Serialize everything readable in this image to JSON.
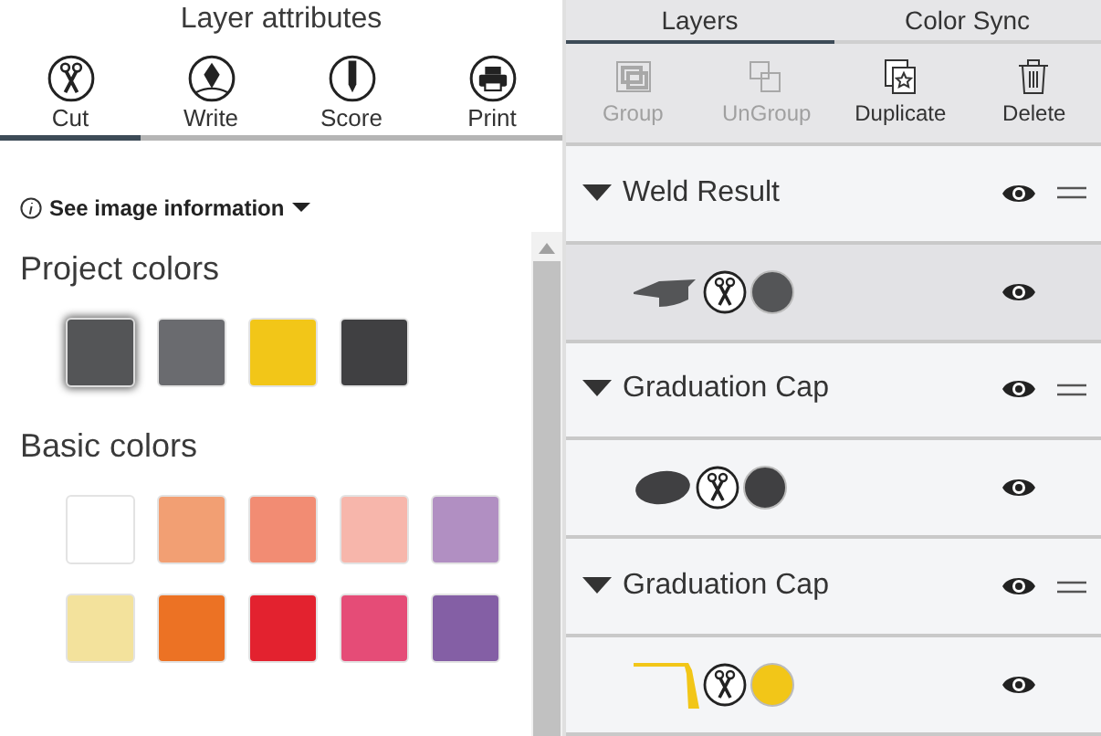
{
  "left_panel": {
    "title": "Layer attributes",
    "tabs": [
      {
        "label": "Cut",
        "kind": "cut",
        "selected": true
      },
      {
        "label": "Write",
        "kind": "write",
        "selected": false
      },
      {
        "label": "Score",
        "kind": "score",
        "selected": false
      },
      {
        "label": "Print",
        "kind": "print",
        "selected": false
      }
    ],
    "info_link": "See image information",
    "sections": [
      {
        "title": "Project colors",
        "swatches": [
          {
            "color": "#545557",
            "selected": true
          },
          {
            "color": "#6a6b6f",
            "selected": false
          },
          {
            "color": "#f2c618",
            "selected": false
          },
          {
            "color": "#404042",
            "selected": false
          }
        ]
      },
      {
        "title": "Basic colors",
        "swatches": [
          {
            "color": "#ffffff",
            "selected": false
          },
          {
            "color": "#f29f73",
            "selected": false
          },
          {
            "color": "#f28c73",
            "selected": false
          },
          {
            "color": "#f7b6ab",
            "selected": false
          },
          {
            "color": "#b18fc2",
            "selected": false
          },
          {
            "color": "#f3e29c",
            "selected": false
          },
          {
            "color": "#ec7224",
            "selected": false
          },
          {
            "color": "#e3222f",
            "selected": false
          },
          {
            "color": "#e54c77",
            "selected": false
          },
          {
            "color": "#845fa5",
            "selected": false
          }
        ]
      }
    ]
  },
  "right_panel": {
    "tabs": [
      {
        "label": "Layers",
        "selected": true
      },
      {
        "label": "Color Sync",
        "selected": false
      }
    ],
    "toolbar": [
      {
        "label": "Group",
        "kind": "group",
        "disabled": true
      },
      {
        "label": "UnGroup",
        "kind": "ungroup",
        "disabled": true
      },
      {
        "label": "Duplicate",
        "kind": "duplicate",
        "disabled": false
      },
      {
        "label": "Delete",
        "kind": "delete",
        "disabled": false
      }
    ],
    "layers": [
      {
        "kind": "group",
        "name": "Weld Result",
        "expanded": true
      },
      {
        "kind": "cap",
        "color": "#545557",
        "selected": true
      },
      {
        "kind": "group",
        "name": "Graduation Cap",
        "expanded": true
      },
      {
        "kind": "oval",
        "color": "#404042",
        "selected": false
      },
      {
        "kind": "group",
        "name": "Graduation Cap",
        "expanded": true
      },
      {
        "kind": "tassel",
        "color": "#f2c618",
        "selected": false
      }
    ]
  }
}
